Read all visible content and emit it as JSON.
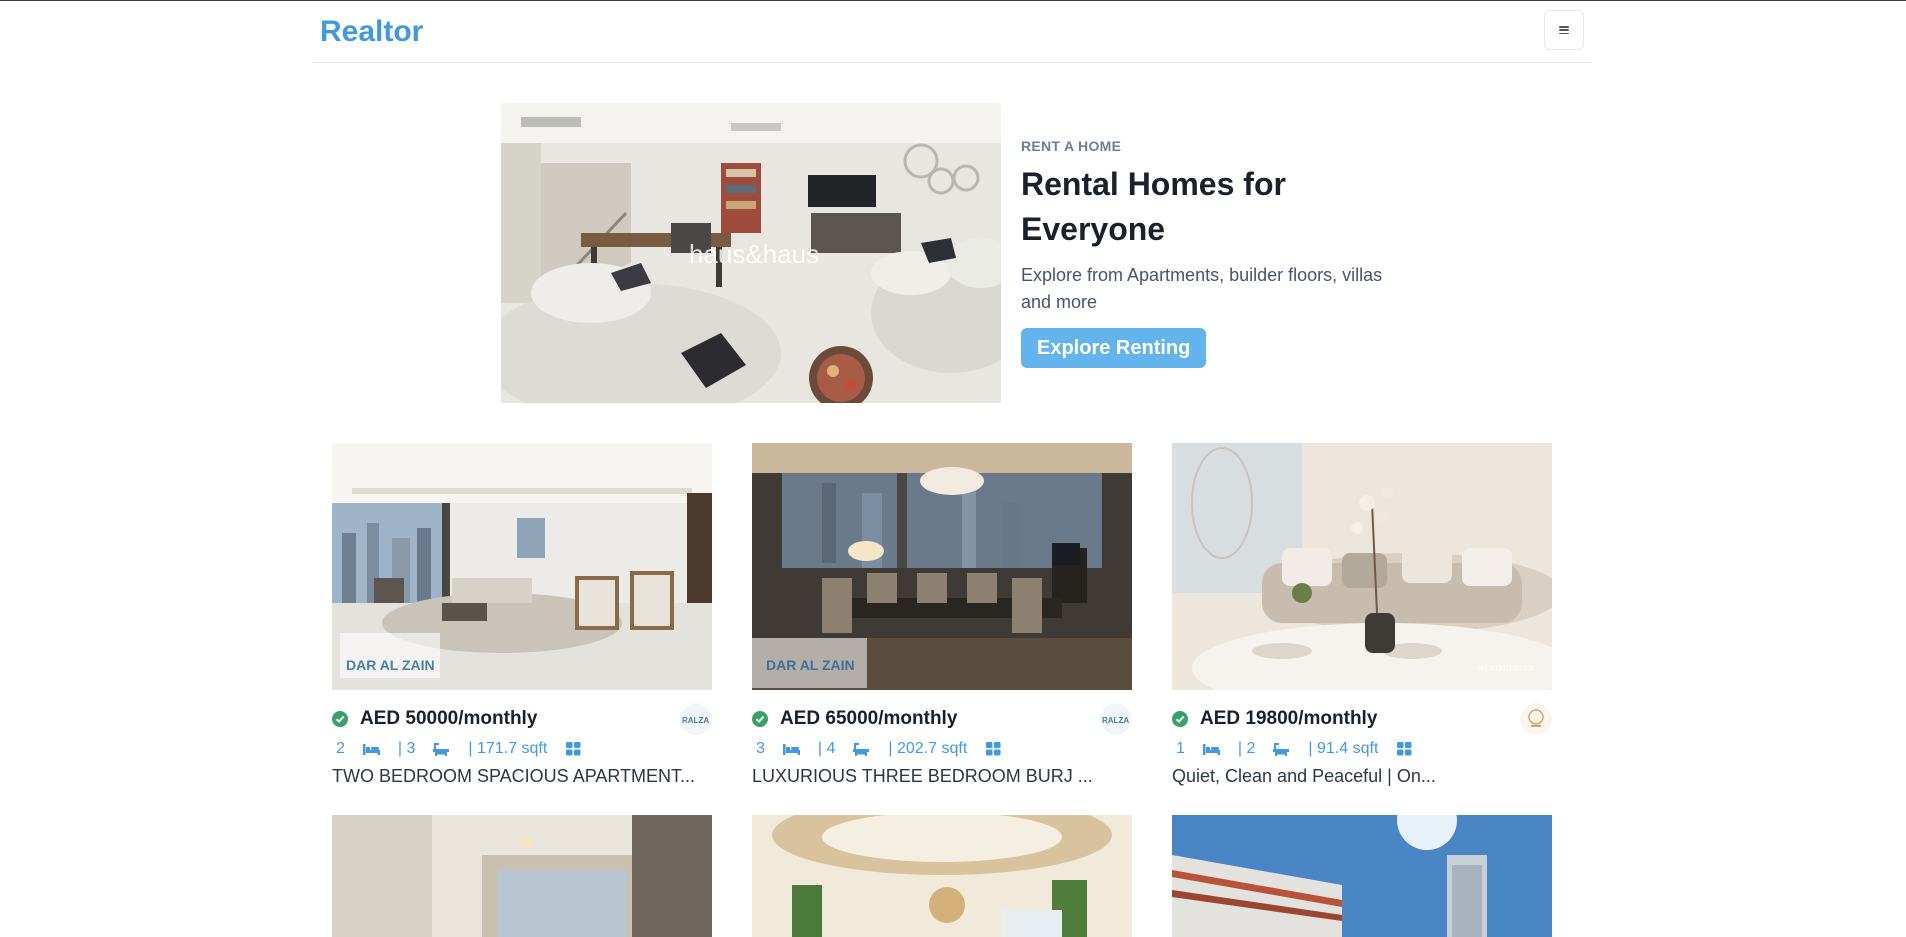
{
  "navbar": {
    "logo": "Realtor",
    "menu_icon": "hamburger-icon"
  },
  "hero": {
    "image_watermark": "haus&haus",
    "eyebrow": "RENT A HOME",
    "title_line1": "Rental Homes for",
    "title_line2": "Everyone",
    "description": "Explore from Apartments, builder floors, villas and more",
    "button_label": "Explore Renting",
    "button_color": "#63b3ed"
  },
  "colors": {
    "brand": "#4299e1",
    "verified": "#38a169"
  },
  "properties": [
    {
      "price": "AED 50000/monthly",
      "rooms": "2",
      "baths": "| 3",
      "area": "| 171.7 sqft",
      "title": "TWO BEDROOM SPACIOUS APARTMENT...",
      "image_watermark": "DAR AL ZAIN",
      "agency_logo": "RALZA"
    },
    {
      "price": "AED 65000/monthly",
      "rooms": "3",
      "baths": "| 4",
      "area": "| 202.7 sqft",
      "title": "LUXURIOUS THREE BEDROOM BURJ ...",
      "image_watermark": "DAR AL ZAIN",
      "agency_logo": "RALZA"
    },
    {
      "price": "AED 19800/monthly",
      "rooms": "1",
      "baths": "| 2",
      "area": "| 91.4 sqft",
      "title": "Quiet, Clean and Peaceful | On...",
      "image_watermark": "WESTMINSTER",
      "agency_logo": "crest"
    }
  ],
  "icons": {
    "verified": "check-circle-icon",
    "rooms": "bed-icon",
    "baths": "bath-icon",
    "area": "grid-icon"
  }
}
